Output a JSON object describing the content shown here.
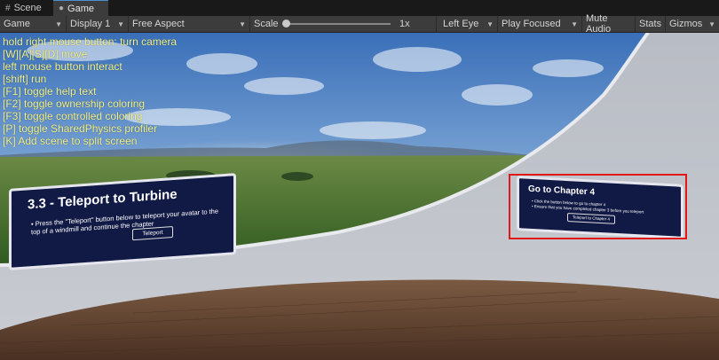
{
  "tabs": [
    {
      "label": "Scene",
      "icon": "grid-icon"
    },
    {
      "label": "Game",
      "icon": "gamepad-icon",
      "active": true
    }
  ],
  "toolbar": {
    "view": "Game",
    "display": "Display 1",
    "aspect": "Free Aspect",
    "scale_label": "Scale",
    "scale_value": "1x",
    "eye": "Left Eye",
    "play_mode": "Play Focused",
    "mute": "Mute Audio",
    "stats": "Stats",
    "gizmos": "Gizmos"
  },
  "help_lines": [
    "hold right mouse button: turn camera",
    "[W][A][S][D] move",
    "left mouse button interact",
    "[shift] run",
    "[F1] toggle help text",
    "[F2] toggle ownership coloring",
    "[F3] toggle controlled coloring",
    "[P] toggle SharedPhysics profiler",
    "[K] Add scene to split screen"
  ],
  "panel_left": {
    "title": "3.3 - Teleport to Turbine",
    "bullet": "Press the \"Teleport\" button below to teleport your avatar to the top of a windmill and continue the chapter",
    "button": "Teleport"
  },
  "panel_right": {
    "title": "Go to Chapter 4",
    "bullet1": "Click the button below to go to chapter 4",
    "bullet2": "Ensure that you have completed chapter 3 before you teleport",
    "button": "Teleport to Chapter 4"
  },
  "colors": {
    "highlight": "#e01818",
    "help_text": "#f2f28a",
    "panel_bg": "#111a45"
  }
}
